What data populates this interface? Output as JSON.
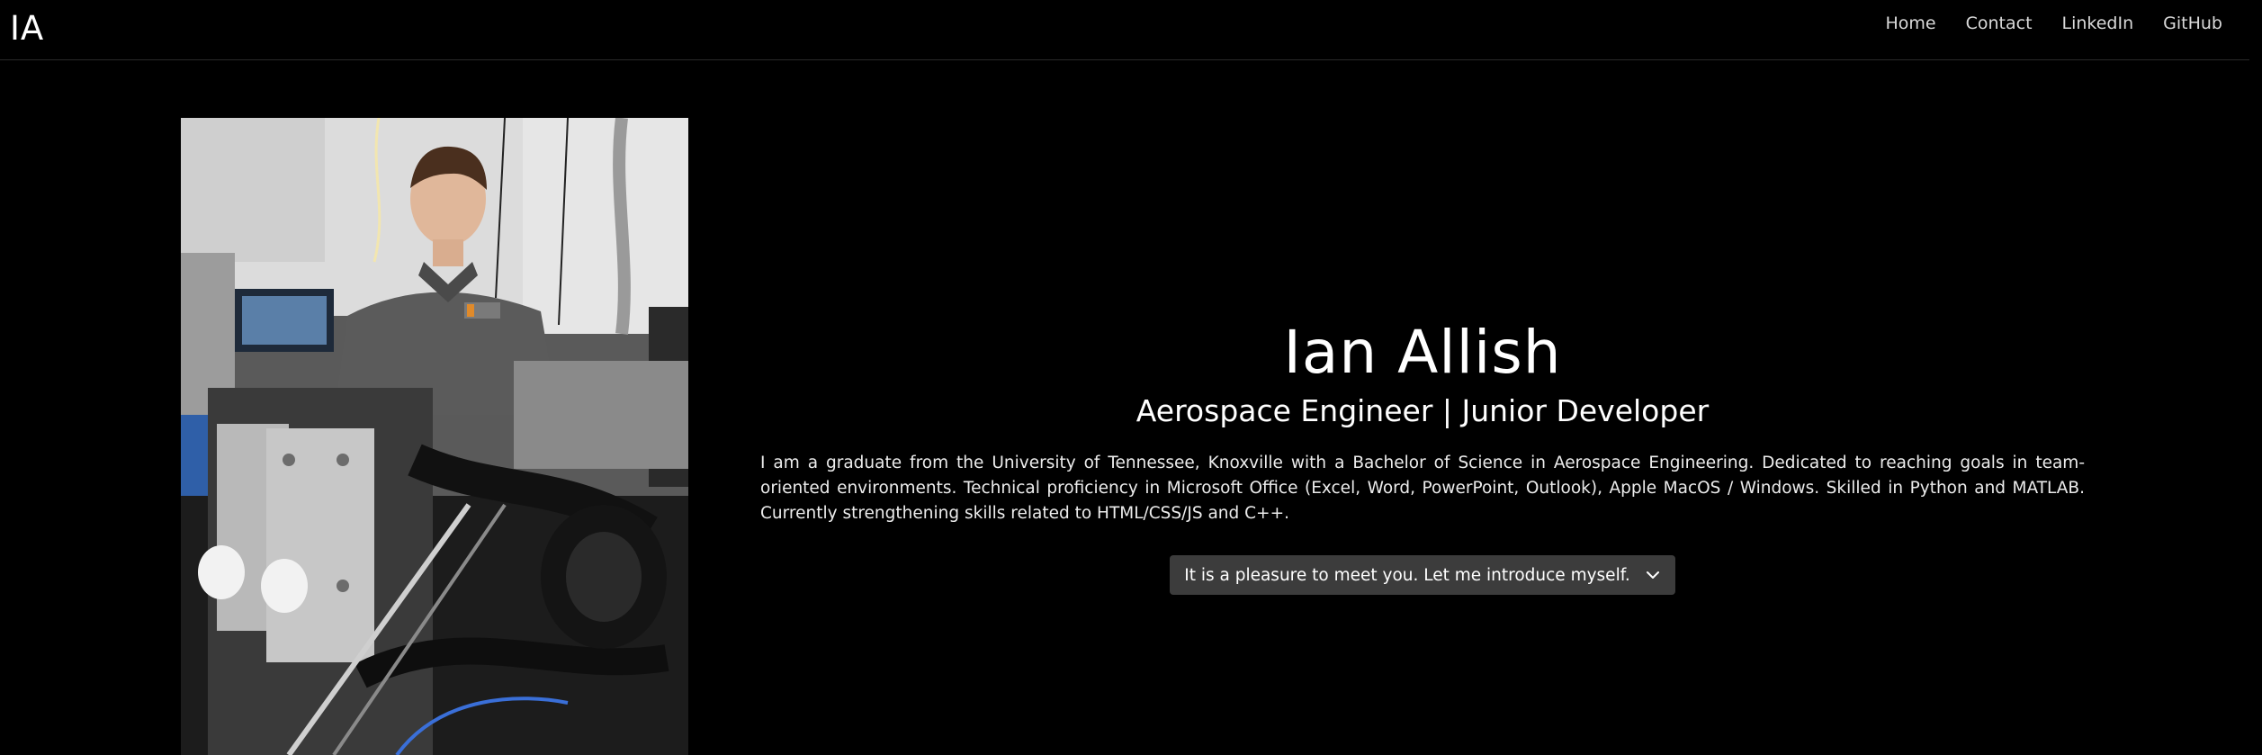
{
  "header": {
    "logo": "IA",
    "nav": [
      "Home",
      "Contact",
      "LinkedIn",
      "GitHub"
    ]
  },
  "hero": {
    "name": "Ian Allish",
    "subtitle": "Aerospace Engineer | Junior Developer",
    "bio": "I am a graduate from the University of Tennessee, Knoxville with a Bachelor of Science in Aerospace Engineering. Dedicated to reaching goals in team-oriented environments. Technical proficiency in Microsoft Office (Excel, Word, PowerPoint, Outlook), Apple MacOS / Windows. Skilled in Python and MATLAB. Currently strengthening skills related to HTML/CSS/JS and C++.",
    "intro_button": "It is a pleasure to meet you. Let me introduce myself.",
    "intro_icon": "chevron-down-icon"
  },
  "colors": {
    "background": "#000000",
    "button_bg": "#3c3c3c",
    "text": "#ffffff"
  }
}
